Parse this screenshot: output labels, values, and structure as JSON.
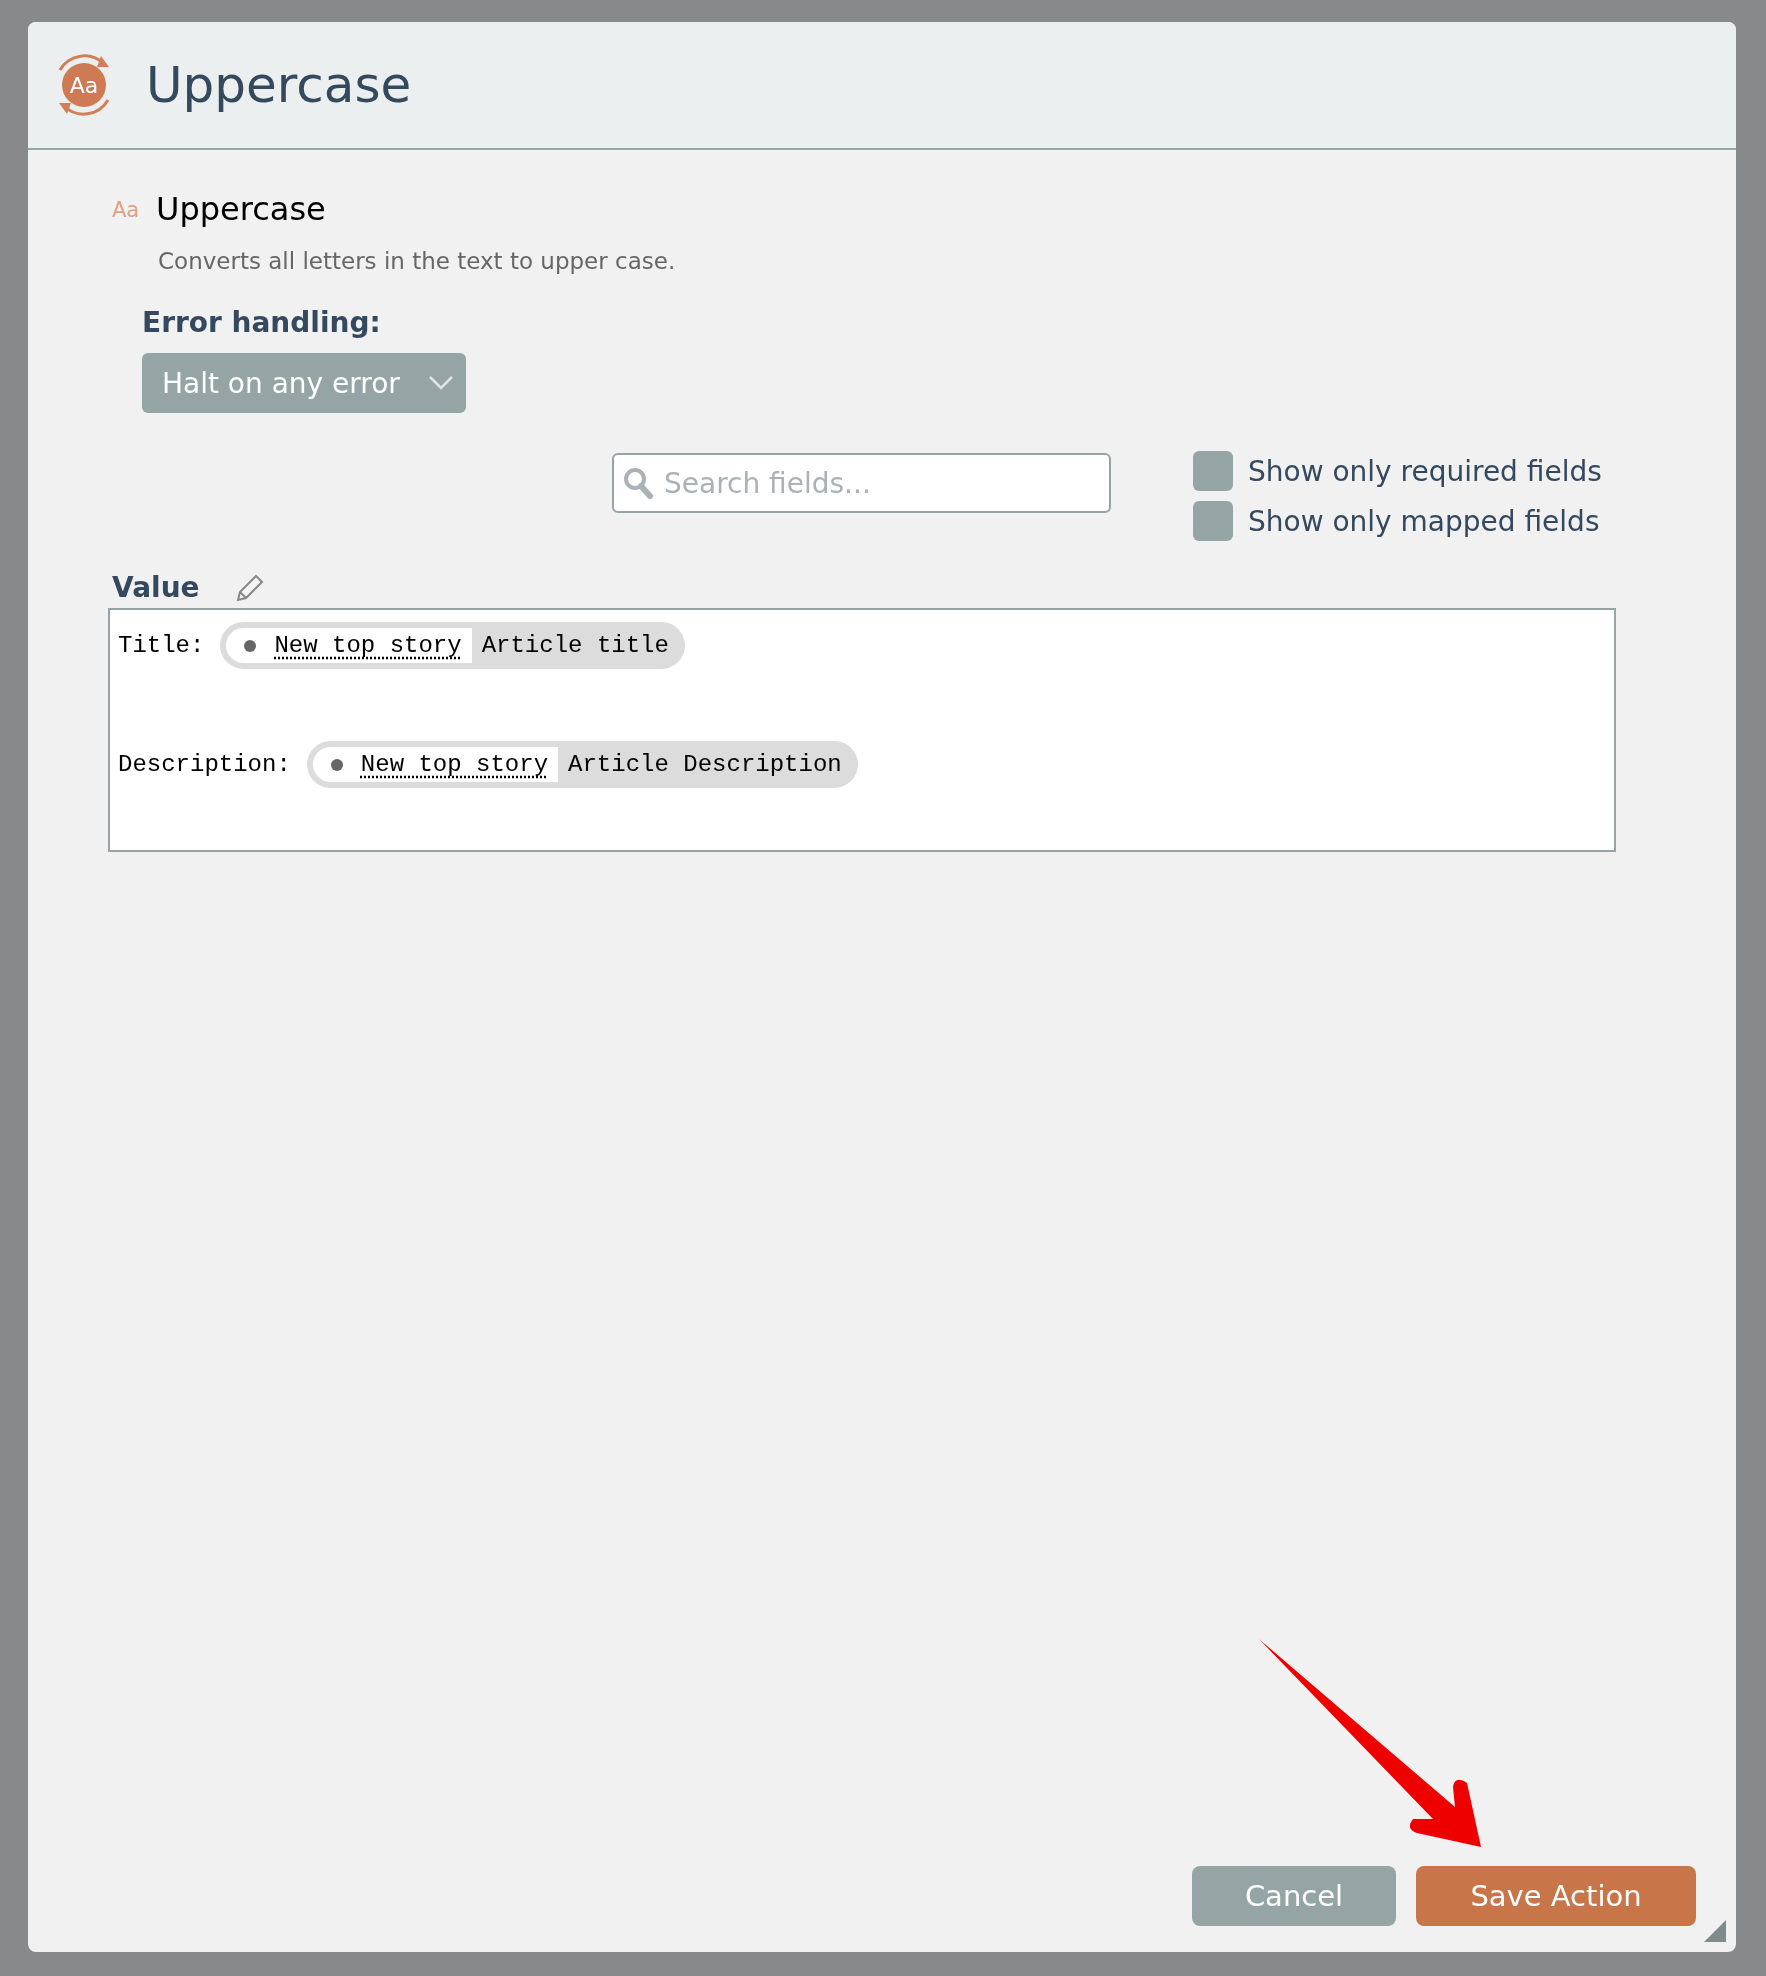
{
  "dialog": {
    "title": "Uppercase",
    "icon_text": "Aa"
  },
  "action": {
    "icon_text": "Aa",
    "name": "Uppercase",
    "description": "Converts all letters in the text to upper case."
  },
  "error_handling": {
    "label": "Error handling:",
    "value": "Halt on any error"
  },
  "search": {
    "placeholder": "Search fields..."
  },
  "filters": [
    {
      "label": "Show only required fields",
      "checked": false
    },
    {
      "label": "Show only mapped fields",
      "checked": false
    }
  ],
  "value": {
    "label": "Value",
    "lines": [
      {
        "label": "Title:",
        "source": "New top story",
        "field": "Article title"
      },
      {
        "label": "Description:",
        "source": "New top story",
        "field": "Article Description"
      }
    ]
  },
  "buttons": [
    {
      "label": "Cancel",
      "kind": "secondary"
    },
    {
      "label": "Save Action",
      "kind": "primary"
    }
  ]
}
